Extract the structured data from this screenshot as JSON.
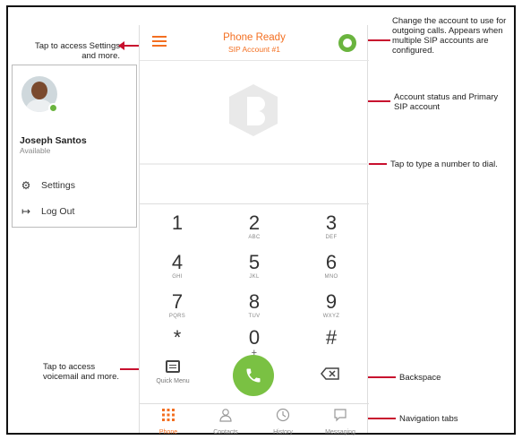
{
  "callouts": {
    "settings": "Tap to access Settings and more.",
    "account_switch": "Change the account to use for outgoing calls. Appears when multiple SIP accounts are configured.",
    "account_status": "Account status and Primary SIP account",
    "dial": "Tap to type a number to dial.",
    "voicemail": "Tap to access voicemail and more.",
    "backspace": "Backspace",
    "nav": "Navigation tabs"
  },
  "drawer": {
    "user_name": "Joseph Santos",
    "user_status": "Available",
    "settings_label": "Settings",
    "logout_label": "Log Out"
  },
  "phone": {
    "status_title": "Phone Ready",
    "account_label": "SIP Account #1",
    "input_value": "",
    "keys": [
      {
        "digit": "1",
        "letters": ""
      },
      {
        "digit": "2",
        "letters": "ABC"
      },
      {
        "digit": "3",
        "letters": "DEF"
      },
      {
        "digit": "4",
        "letters": "GHI"
      },
      {
        "digit": "5",
        "letters": "JKL"
      },
      {
        "digit": "6",
        "letters": "MNO"
      },
      {
        "digit": "7",
        "letters": "PQRS"
      },
      {
        "digit": "8",
        "letters": "TUV"
      },
      {
        "digit": "9",
        "letters": "WXYZ"
      },
      {
        "digit": "*",
        "letters": ""
      },
      {
        "digit": "0",
        "letters": "+"
      },
      {
        "digit": "#",
        "letters": ""
      }
    ],
    "quick_menu_label": "Quick Menu",
    "tabs": [
      {
        "label": "Phone",
        "icon": "keypad-icon"
      },
      {
        "label": "Contacts",
        "icon": "contacts-icon"
      },
      {
        "label": "History",
        "icon": "clock-icon"
      },
      {
        "label": "Messaging",
        "icon": "chat-icon"
      }
    ]
  },
  "colors": {
    "accent": "#f36f21",
    "call_green": "#7ac143",
    "arrow_red": "#c8102e",
    "status_green": "#6ab43e"
  }
}
